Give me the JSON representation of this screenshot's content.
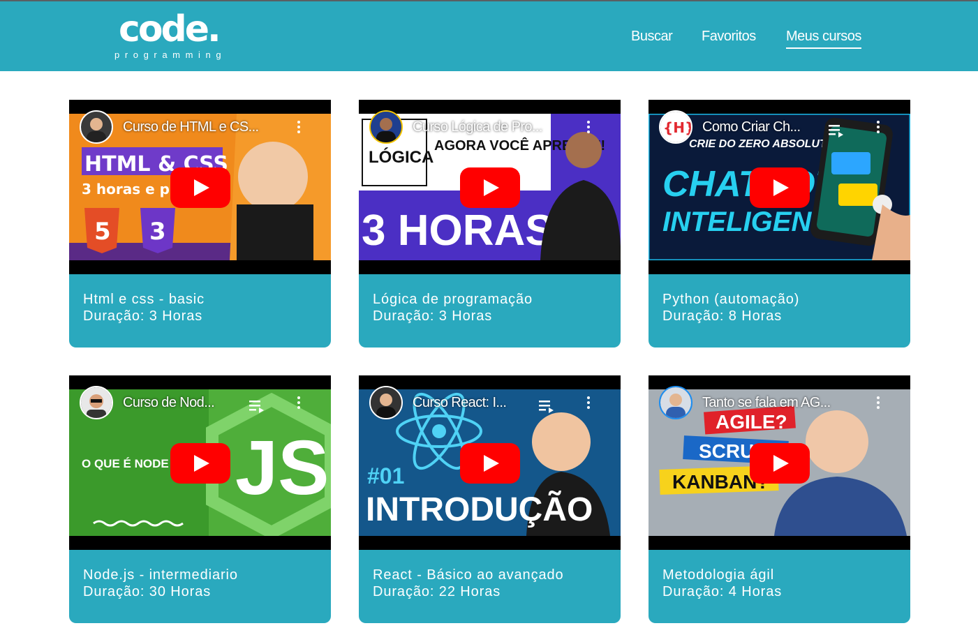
{
  "logo": {
    "main": "code.",
    "sub": "programming"
  },
  "nav": [
    {
      "label": "Buscar",
      "active": false
    },
    {
      "label": "Favoritos",
      "active": false
    },
    {
      "label": "Meus cursos",
      "active": true
    }
  ],
  "courses": [
    {
      "video_title": "Curso de HTML e CS...",
      "name": "Html e css - basic",
      "duration": "Duração: 3 Horas",
      "thumb_text": [
        "HTML & CSS",
        "3 horas e p"
      ]
    },
    {
      "video_title": "Curso Lógica de Pro...",
      "name": "Lógica de programação",
      "duration": "Duração: 3 Horas",
      "thumb_text": [
        "LÓGICA",
        "AGORA VOCÊ APRENDE!",
        "3 HORAS"
      ]
    },
    {
      "video_title": "Como Criar Ch...",
      "name": "Python (automação)",
      "duration": "Duração: 8 Horas",
      "thumb_text": [
        "CRIE DO ZERO ABSOLUTO",
        "CHATBOT",
        "INTELIGENTE"
      ]
    },
    {
      "video_title": "Curso de Nod...",
      "name": "Node.js - intermediario",
      "duration": "Duração: 30 Horas",
      "thumb_text": [
        "O QUE É NODE",
        "JS"
      ]
    },
    {
      "video_title": "Curso React: I...",
      "name": "React - Básico ao avançado",
      "duration": "Duração: 22 Horas",
      "thumb_text": [
        "#01",
        "INTRODUÇÃO"
      ]
    },
    {
      "video_title": "Tanto se fala em AG...",
      "name": "Metodologia ágil",
      "duration": "Duração: 4 Horas",
      "thumb_text": [
        "AGILE?",
        "SCRUM?",
        "KANBAN?"
      ]
    }
  ],
  "colors": {
    "header": "#2aa9be",
    "card": "#2aa9be",
    "youtube_red": "#ff0000"
  },
  "icons": [
    "youtube-play-icon",
    "more-vert-icon",
    "playlist-icon"
  ]
}
